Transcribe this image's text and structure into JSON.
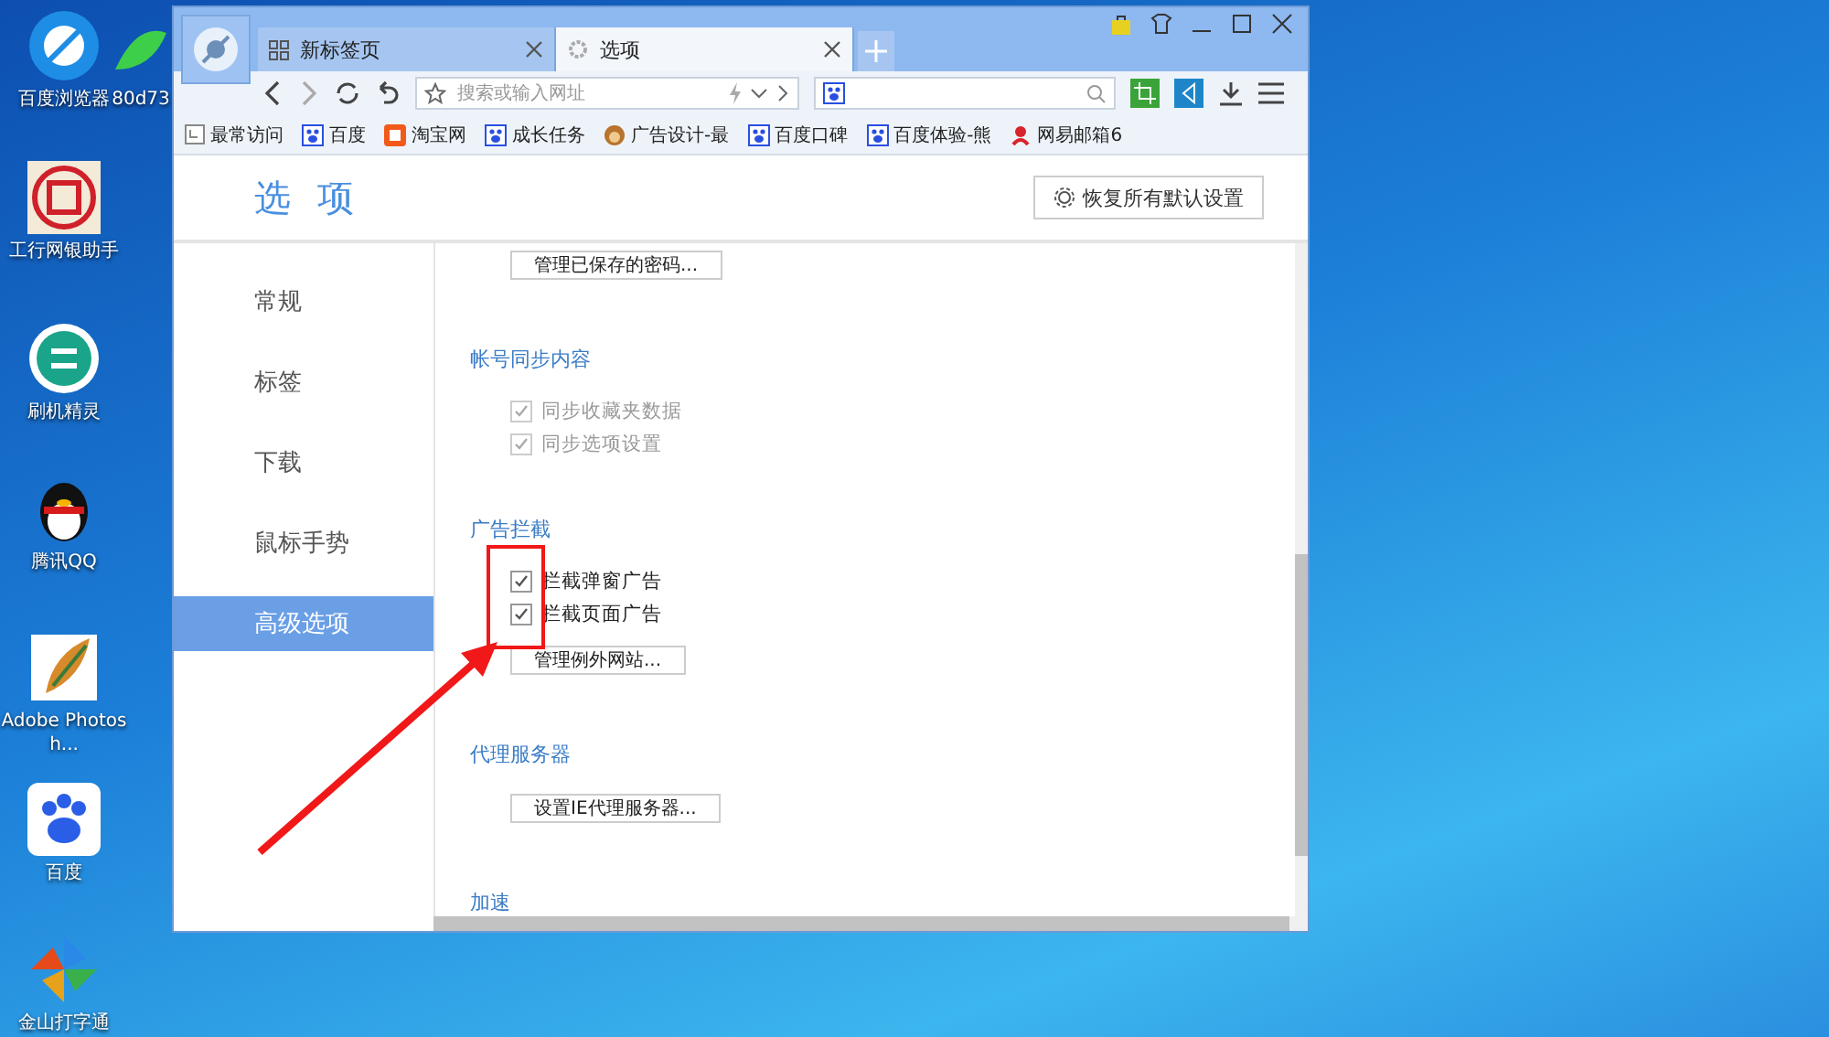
{
  "desktop": {
    "icons": [
      {
        "label": "百度浏览器",
        "kind": "browser"
      },
      {
        "label": "80d73",
        "kind": "leaf"
      },
      {
        "label": "工行网银助手",
        "kind": "bank"
      },
      {
        "label": "刷机精灵",
        "kind": "shield"
      },
      {
        "label": "腾讯QQ",
        "kind": "penguin"
      },
      {
        "label": "Adobe Photosh...",
        "kind": "feather"
      },
      {
        "label": "百度",
        "kind": "paw"
      },
      {
        "label": "金山打字通",
        "kind": "pinwheel"
      }
    ]
  },
  "window": {
    "tabs": [
      {
        "label": "新标签页",
        "selected": false
      },
      {
        "label": "选项",
        "selected": true
      }
    ],
    "address_bar": {
      "placeholder": "搜索或输入网址"
    },
    "bookmarks": [
      {
        "label": "最常访问",
        "kind": "page"
      },
      {
        "label": "百度",
        "kind": "paw"
      },
      {
        "label": "淘宝网",
        "kind": "taobao"
      },
      {
        "label": "成长任务",
        "kind": "paw"
      },
      {
        "label": "广告设计-最",
        "kind": "monkey"
      },
      {
        "label": "百度口碑",
        "kind": "paw"
      },
      {
        "label": "百度体验-熊",
        "kind": "paw"
      },
      {
        "label": "网易邮箱6",
        "kind": "mail"
      }
    ]
  },
  "options": {
    "title": "选 项",
    "reset_button": "恢复所有默认设置",
    "sidebar": {
      "items": [
        {
          "label": "常规",
          "selected": false
        },
        {
          "label": "标签",
          "selected": false
        },
        {
          "label": "下载",
          "selected": false
        },
        {
          "label": "鼠标手势",
          "selected": false
        },
        {
          "label": "高级选项",
          "selected": true
        }
      ]
    },
    "content": [
      {
        "kind": "button",
        "label": "管理已保存的密码..."
      },
      {
        "kind": "heading",
        "label": "帐号同步内容"
      },
      {
        "kind": "checkbox",
        "label": "同步收藏夹数据",
        "checked": true,
        "disabled": true
      },
      {
        "kind": "checkbox",
        "label": "同步选项设置",
        "checked": true,
        "disabled": true
      },
      {
        "kind": "heading",
        "label": "广告拦截"
      },
      {
        "kind": "checkbox",
        "label": "拦截弹窗广告",
        "checked": true,
        "disabled": false
      },
      {
        "kind": "checkbox",
        "label": "拦截页面广告",
        "checked": true,
        "disabled": false
      },
      {
        "kind": "button",
        "label": "管理例外网站..."
      },
      {
        "kind": "heading",
        "label": "代理服务器"
      },
      {
        "kind": "button",
        "label": "设置IE代理服务器..."
      },
      {
        "kind": "heading",
        "label": "加速"
      }
    ]
  }
}
